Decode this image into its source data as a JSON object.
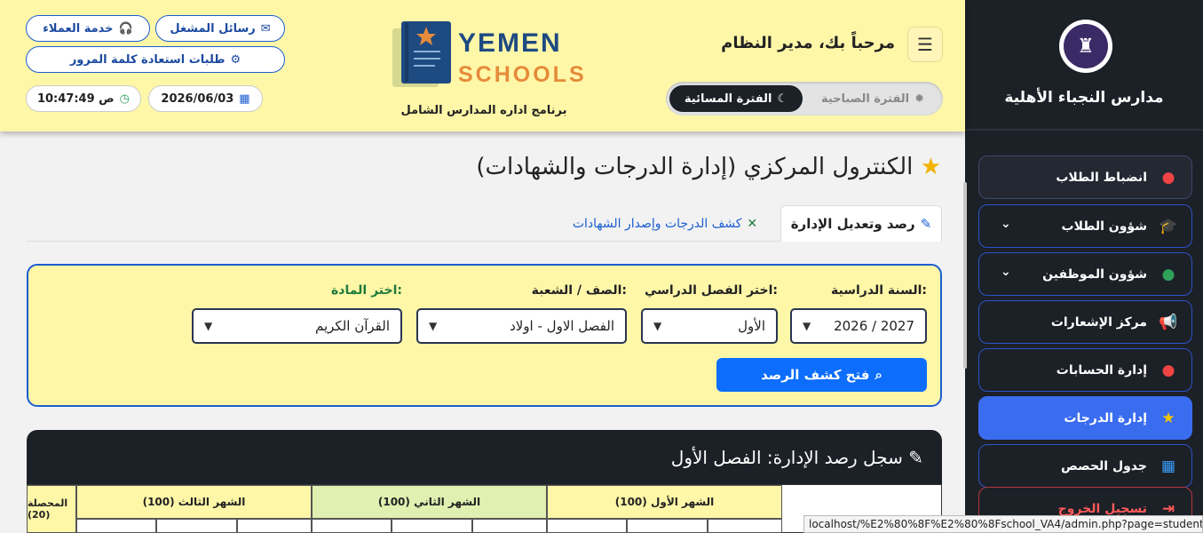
{
  "sidebar": {
    "school_name": "مدارس النجباء الأهلية",
    "items": [
      {
        "label": "انضباط الطلاب",
        "icon": "user-x-icon"
      },
      {
        "label": "شؤون الطلاب",
        "icon": "graduate-icon"
      },
      {
        "label": "شؤون الموظفين",
        "icon": "employee-icon"
      },
      {
        "label": "مركز الإشعارات",
        "icon": "megaphone-icon"
      },
      {
        "label": "إدارة الحسابات",
        "icon": "user-gear-icon"
      },
      {
        "label": "إدارة الدرجات",
        "icon": "star-icon"
      },
      {
        "label": "جدول الحصص",
        "icon": "calendar-icon"
      },
      {
        "label": "تسجيل الخروج",
        "icon": "logout-icon"
      }
    ]
  },
  "header": {
    "welcome": "مرحباً بك، مدير النظام",
    "customer_service": "خدمة العملاء",
    "operator_messages": "رسائل المشغل",
    "password_requests": "طلبات استعادة كلمة المرور",
    "time": "10:47:49 ص",
    "date": "2026/06/03",
    "period_morning": "الفترة الصباحية",
    "period_evening": "الفترة المسائية",
    "logo_word1": "YEMEN",
    "logo_word2": "SCHOOLS",
    "logo_sub": "برنامج اداره المدارس الشامل"
  },
  "main": {
    "page_title": "الكنترول المركزي (إدارة الدرجات والشهادات)",
    "tabs": [
      {
        "label": "رصد وتعديل الإدارة",
        "active": true
      },
      {
        "label": "كشف الدرجات وإصدار الشهادات",
        "active": false
      }
    ],
    "filters": {
      "year_label": "السنة الدراسية:",
      "year_value": "2026 / 2027",
      "term_label": "اختر الفصل الدراسي:",
      "term_value": "الأول",
      "class_label": "الصف / الشعبة:",
      "class_value": "الفصل الاول - اولاد",
      "subject_label": "اختر المادة:",
      "subject_value": "القرآن الكريم",
      "open_button": "فتح كشف الرصد"
    },
    "record": {
      "title": "سجل رصد الإدارة: الفصل الأول",
      "headers": [
        "الشهر الأول (100)",
        "الشهر الثاني (100)",
        "الشهر الثالث (100)",
        "المحصلة (20)"
      ]
    }
  },
  "status_url": "localhost/%E2%80%8F%E2%80%8Fschool_VA4/admin.php?page=student_discipli...",
  "colors": {
    "accent": "#0d6efd",
    "header_bg": "#fff7a8",
    "sidebar_bg": "#1c2027"
  }
}
